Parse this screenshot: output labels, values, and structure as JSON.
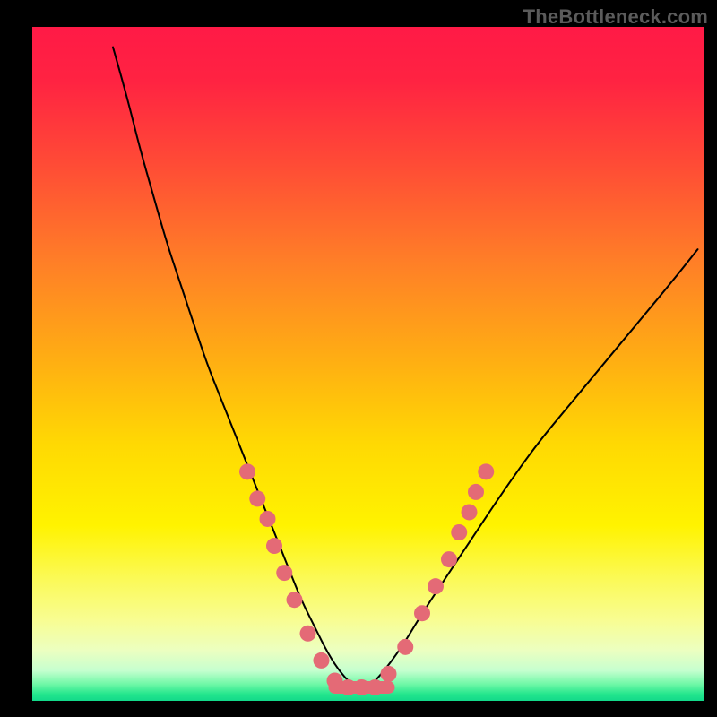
{
  "watermark": {
    "text": "TheBottleneck.com"
  },
  "chart_data": {
    "type": "line",
    "title": "",
    "xlabel": "",
    "ylabel": "",
    "xlim": [
      0,
      100
    ],
    "ylim": [
      0,
      100
    ],
    "grid": false,
    "legend": false,
    "background_gradient": {
      "orientation": "vertical",
      "stops": [
        {
          "offset": 0.0,
          "color": "#ff1a46"
        },
        {
          "offset": 0.08,
          "color": "#ff2342"
        },
        {
          "offset": 0.2,
          "color": "#ff4a36"
        },
        {
          "offset": 0.35,
          "color": "#ff7f27"
        },
        {
          "offset": 0.5,
          "color": "#ffb012"
        },
        {
          "offset": 0.62,
          "color": "#ffd903"
        },
        {
          "offset": 0.74,
          "color": "#fff300"
        },
        {
          "offset": 0.82,
          "color": "#fbfa58"
        },
        {
          "offset": 0.88,
          "color": "#f8fd92"
        },
        {
          "offset": 0.925,
          "color": "#ecffc0"
        },
        {
          "offset": 0.955,
          "color": "#c6ffcf"
        },
        {
          "offset": 0.975,
          "color": "#70f8a7"
        },
        {
          "offset": 0.99,
          "color": "#24e68d"
        },
        {
          "offset": 1.0,
          "color": "#12d98a"
        }
      ]
    },
    "series": [
      {
        "name": "bottleneck-curve",
        "color": "#000000",
        "stroke_width": 2,
        "x": [
          12,
          14,
          16,
          18,
          20,
          22,
          24,
          26,
          28,
          30,
          32,
          34,
          36,
          38,
          40,
          42,
          44,
          46,
          48,
          50,
          52,
          55,
          58,
          62,
          66,
          70,
          75,
          80,
          85,
          90,
          95,
          99
        ],
        "y": [
          97,
          90,
          82,
          75,
          68,
          62,
          56,
          50,
          45,
          40,
          35,
          30,
          25,
          20,
          15,
          11,
          7,
          4,
          2,
          2,
          4,
          8,
          13,
          19,
          25,
          31,
          38,
          44,
          50,
          56,
          62,
          67
        ]
      }
    ],
    "optimal_range": {
      "x_start": 45,
      "x_end": 53,
      "y": 2
    },
    "markers": {
      "color": "#e46a76",
      "radius": 9,
      "points": [
        {
          "x": 32.0,
          "y": 34
        },
        {
          "x": 33.5,
          "y": 30
        },
        {
          "x": 35.0,
          "y": 27
        },
        {
          "x": 36.0,
          "y": 23
        },
        {
          "x": 37.5,
          "y": 19
        },
        {
          "x": 39.0,
          "y": 15
        },
        {
          "x": 41.0,
          "y": 10
        },
        {
          "x": 43.0,
          "y": 6
        },
        {
          "x": 45.0,
          "y": 3
        },
        {
          "x": 47.0,
          "y": 2
        },
        {
          "x": 49.0,
          "y": 2
        },
        {
          "x": 51.0,
          "y": 2
        },
        {
          "x": 53.0,
          "y": 4
        },
        {
          "x": 55.5,
          "y": 8
        },
        {
          "x": 58.0,
          "y": 13
        },
        {
          "x": 60.0,
          "y": 17
        },
        {
          "x": 62.0,
          "y": 21
        },
        {
          "x": 63.5,
          "y": 25
        },
        {
          "x": 65.0,
          "y": 28
        },
        {
          "x": 66.0,
          "y": 31
        },
        {
          "x": 67.5,
          "y": 34
        }
      ]
    }
  }
}
